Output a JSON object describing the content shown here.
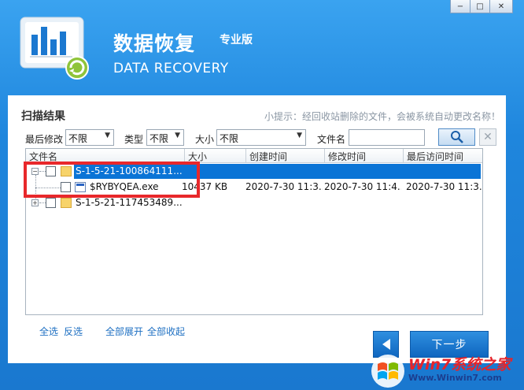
{
  "header": {
    "title_cn": "数据恢复",
    "badge": "专业版",
    "title_en": "DATA RECOVERY"
  },
  "window_controls": {
    "minimize": "−",
    "maximize": "□",
    "close": "✕"
  },
  "results": {
    "title": "扫描结果",
    "hint": "小提示：经回收站删除的文件，会被系统自动更改名称！"
  },
  "filters": {
    "last_modified_label": "最后修改",
    "last_modified_value": "不限",
    "type_label": "类型",
    "type_value": "不限",
    "size_label": "大小",
    "size_value": "不限",
    "filename_label": "文件名",
    "filename_value": ""
  },
  "columns": [
    "文件名",
    "大小",
    "创建时间",
    "修改时间",
    "最后访问时间"
  ],
  "rows": [
    {
      "name": "S-1-5-21-100864111...",
      "size": "",
      "created": "",
      "modified": "",
      "accessed": "",
      "expander": "−"
    },
    {
      "name": "$RYBYQEA.exe",
      "size": "10437 KB",
      "created": "2020-7-30 11:3...",
      "modified": "2020-7-30 11:4...",
      "accessed": "2020-7-30 11:3..."
    },
    {
      "name": "S-1-5-21-117453489...",
      "size": "",
      "created": "",
      "modified": "",
      "accessed": "",
      "expander": "+"
    }
  ],
  "actions": {
    "select_all": "全选",
    "invert": "反选",
    "expand_all": "全部展开",
    "collapse_all": "全部收起",
    "next": "下一步"
  },
  "watermark": {
    "line1": "Win7系统之家",
    "line2": "Www.Winwin7.com"
  },
  "colors": {
    "accent_blue": "#1a78cf",
    "selection": "#0a74d6",
    "highlight_box": "#e8282b"
  }
}
